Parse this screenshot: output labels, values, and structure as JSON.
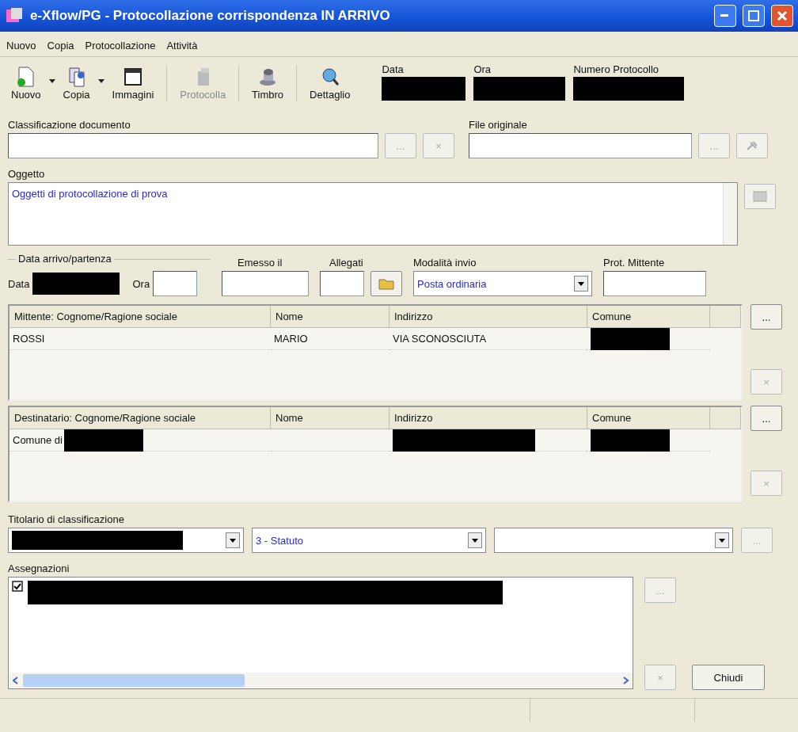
{
  "window": {
    "title": "e-Xflow/PG - Protocollazione corrispondenza IN ARRIVO"
  },
  "menu": [
    "Nuovo",
    "Copia",
    "Protocollazione",
    "Attività"
  ],
  "toolbar": [
    {
      "label": "Nuovo",
      "kind": "new",
      "dropdown": true,
      "disabled": false
    },
    {
      "label": "Copia",
      "kind": "copy",
      "dropdown": true,
      "disabled": false
    },
    {
      "label": "Immagini",
      "kind": "images",
      "dropdown": false,
      "disabled": false
    },
    {
      "label": "Protocolla",
      "kind": "register",
      "dropdown": false,
      "disabled": true
    },
    {
      "label": "Timbro",
      "kind": "stamp",
      "dropdown": false,
      "disabled": false
    },
    {
      "label": "Dettaglio",
      "kind": "detail",
      "dropdown": false,
      "disabled": false
    }
  ],
  "header_fields": [
    {
      "label": "Data",
      "redacted": true
    },
    {
      "label": "Ora",
      "redacted": true
    },
    {
      "label": "Numero Protocollo",
      "redacted": true
    }
  ],
  "classificazione": {
    "label": "Classificazione documento",
    "buttons": [
      {
        "text": "...",
        "disabled": true
      },
      {
        "text": "×",
        "disabled": true
      }
    ]
  },
  "file_originale": {
    "label": "File originale",
    "buttons": [
      {
        "text": "...",
        "disabled": true
      }
    ]
  },
  "oggetto": {
    "label": "Oggetto",
    "value": "Oggetti di protocollazione di prova"
  },
  "data_arrivo": {
    "group_label": "Data arrivo/partenza",
    "date_label": "Data",
    "date_redacted": true,
    "time_label": "Ora"
  },
  "emesso_il": {
    "label": "Emesso il"
  },
  "allegati": {
    "label": "Allegati"
  },
  "modalita_invio": {
    "label": "Modalità invio",
    "value": "Posta ordinaria"
  },
  "prot_mittente": {
    "label": "Prot. Mittente"
  },
  "mittenti": {
    "columns": [
      "Mittente: Cognome/Ragione sociale",
      "Nome",
      "Indirizzo",
      "Comune"
    ],
    "rows": [
      {
        "cells": [
          {
            "text": "ROSSI"
          },
          {
            "text": "MARIO"
          },
          {
            "text": "VIA SCONOSCIUTA"
          },
          {
            "redacted": true
          }
        ]
      }
    ],
    "buttons": [
      {
        "text": "...",
        "disabled": false
      },
      {
        "text": "×",
        "disabled": true
      }
    ]
  },
  "destinatari": {
    "columns": [
      "Destinatario: Cognome/Ragione sociale",
      "Nome",
      "Indirizzo",
      "Comune"
    ],
    "rows": [
      {
        "cells": [
          {
            "text": "Comune di",
            "redacted": true
          },
          {},
          {
            "redacted": true
          },
          {
            "redacted": true
          }
        ]
      }
    ],
    "buttons": [
      {
        "text": "...",
        "disabled": false
      },
      {
        "text": "×",
        "disabled": true
      }
    ]
  },
  "titolario": {
    "label": "Titolario di classificazione",
    "combos": [
      {
        "redacted": true
      },
      {
        "value": "3 - Statuto"
      }
    ],
    "button": {
      "text": "...",
      "disabled": true
    }
  },
  "assegnazioni": {
    "label": "Assegnazioni",
    "items": [
      {
        "checked": true,
        "redacted": true
      }
    ],
    "buttons": [
      {
        "text": "...",
        "disabled": true
      },
      {
        "text": "×",
        "disabled": true
      }
    ]
  },
  "close_button": "Chiudi"
}
